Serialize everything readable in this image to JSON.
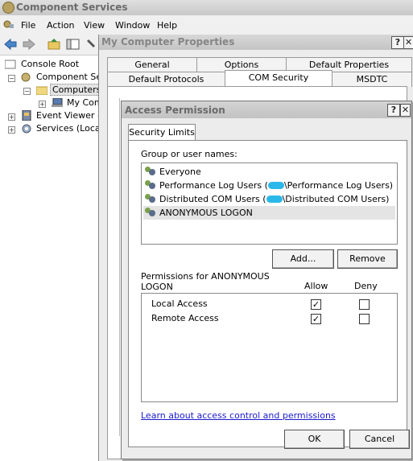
{
  "main_window": {
    "title": "Component Services",
    "menu": [
      "File",
      "Action",
      "View",
      "Window",
      "Help"
    ]
  },
  "tree": {
    "items": [
      {
        "label": "Console Root"
      },
      {
        "label": "Component Serv"
      },
      {
        "label": "Computers"
      },
      {
        "label": "My Com"
      },
      {
        "label": "Event Viewer (L"
      },
      {
        "label": "Services (Local)"
      }
    ]
  },
  "props_window": {
    "title": "My Computer Properties",
    "tabs_row1": [
      "General",
      "Options",
      "Default Properties"
    ],
    "tabs_row2": [
      "Default Protocols",
      "COM Security",
      "MSDTC"
    ],
    "selected_tab": "COM Security"
  },
  "dialog": {
    "title": "Access Permission",
    "tab": "Security Limits",
    "group_label": "Group or user names:",
    "users": [
      {
        "prefix": "Everyone",
        "suffix": ""
      },
      {
        "prefix": "Performance Log Users (",
        "suffix": "\\Performance Log Users)"
      },
      {
        "prefix": "Distributed COM Users (",
        "suffix": "\\Distributed COM Users)"
      },
      {
        "prefix": "ANONYMOUS LOGON",
        "suffix": ""
      }
    ],
    "add_button": "Add...",
    "remove_button": "Remove",
    "permissions_label": "Permissions for ANONYMOUS LOGON",
    "allow_header": "Allow",
    "deny_header": "Deny",
    "permissions": [
      {
        "name": "Local Access",
        "allow": true,
        "deny": false
      },
      {
        "name": "Remote Access",
        "allow": true,
        "deny": false
      }
    ],
    "learn_link": "Learn about access control and permissions",
    "ok_button": "OK",
    "cancel_button": "Cancel"
  }
}
